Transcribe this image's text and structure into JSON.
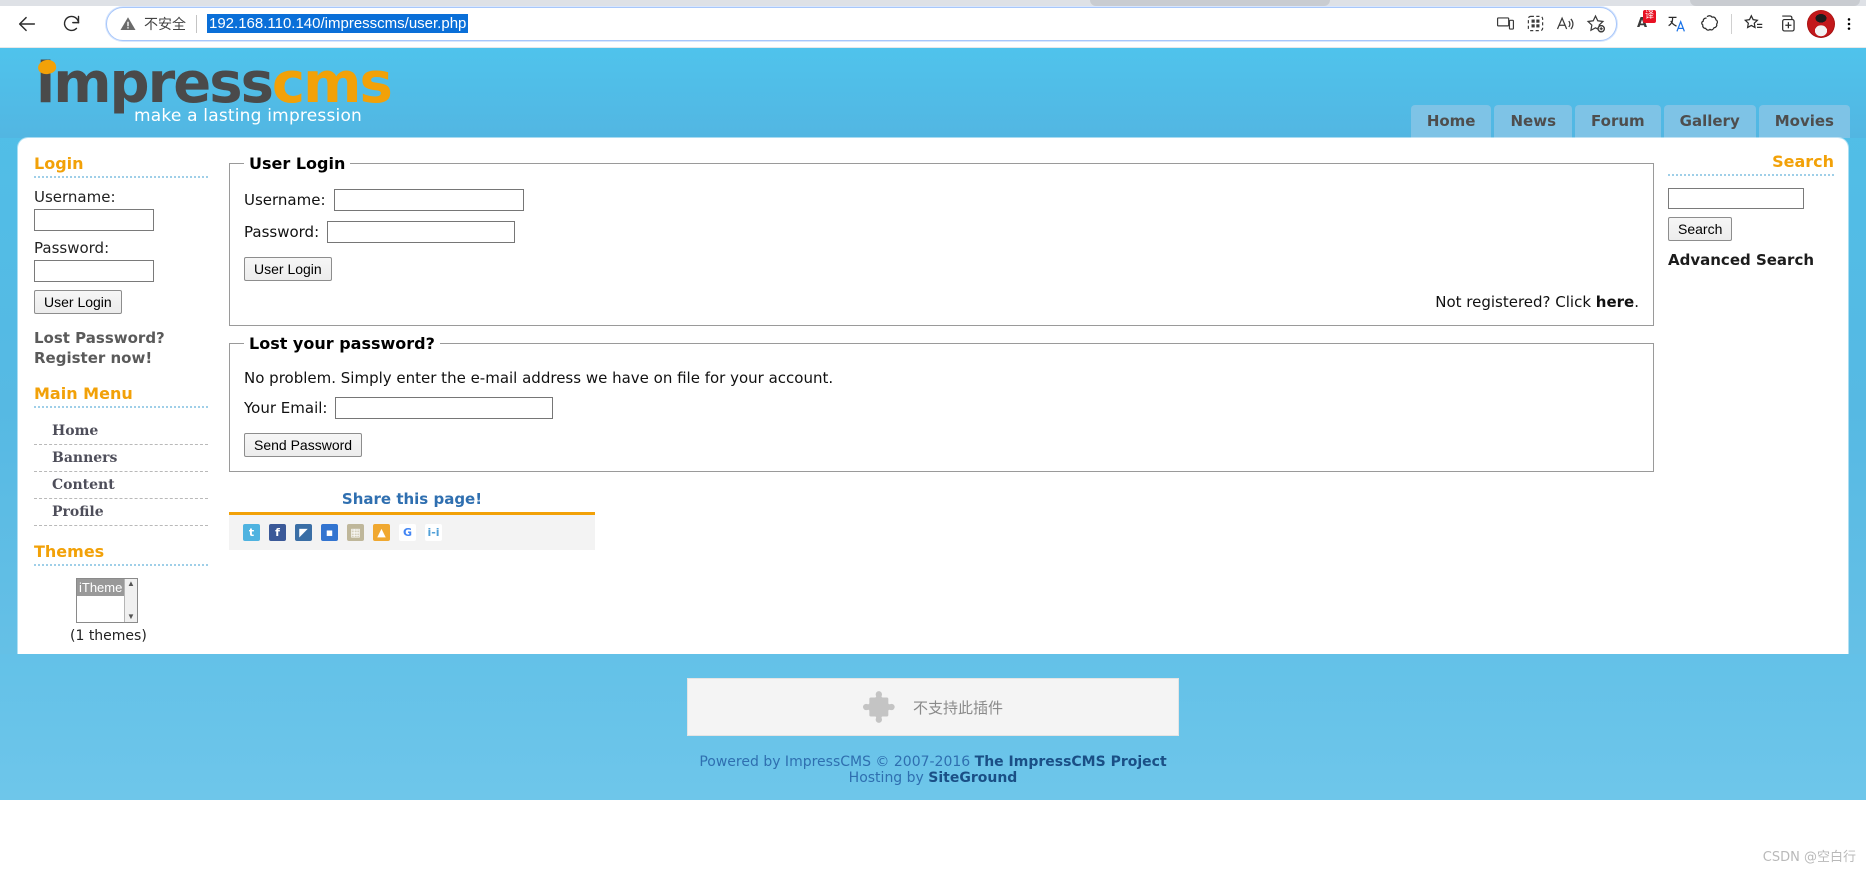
{
  "browser": {
    "back_icon": "back-arrow-icon",
    "reload_icon": "reload-icon",
    "security_warning_icon": "warning-triangle-icon",
    "security_text": "不安全",
    "url": "192.168.110.140/impresscms/user.php",
    "omnibox_icons": [
      "cast-device-icon",
      "split-screen-icon",
      "read-aloud-icon",
      "add-favorite-icon"
    ],
    "toolbar_icons": [
      "translate-badge-icon",
      "translate-icon",
      "copilot-icon",
      "favorites-list-icon",
      "collections-icon",
      "profile-avatar",
      "more-options-icon"
    ],
    "translate_badge": "译"
  },
  "site": {
    "logo": {
      "part1": "impress",
      "part2": "cms",
      "tagline": "make a lasting impression"
    },
    "topnav": [
      {
        "label": "Home"
      },
      {
        "label": "News"
      },
      {
        "label": "Forum"
      },
      {
        "label": "Gallery"
      },
      {
        "label": "Movies"
      }
    ]
  },
  "sidebar": {
    "login_block": {
      "title": "Login",
      "username_label": "Username:",
      "password_label": "Password:",
      "submit_label": "User Login",
      "lost_password": "Lost Password?",
      "register": "Register now!"
    },
    "main_menu": {
      "title": "Main Menu",
      "items": [
        {
          "label": "Home"
        },
        {
          "label": "Banners"
        },
        {
          "label": "Content"
        },
        {
          "label": "Profile"
        }
      ]
    },
    "themes": {
      "title": "Themes",
      "selected_option": "iTheme",
      "count_text": "(1 themes)"
    }
  },
  "main": {
    "user_login": {
      "legend": "User Login",
      "username_label": "Username:",
      "password_label": "Password:",
      "submit_label": "User Login",
      "not_registered_prefix": "Not registered? Click ",
      "not_registered_link": "here",
      "not_registered_suffix": "."
    },
    "lost_password": {
      "legend": "Lost your password?",
      "description": "No problem. Simply enter the e-mail address we have on file for your account.",
      "email_label": "Your Email:",
      "submit_label": "Send Password"
    },
    "share": {
      "title": "Share this page!",
      "icons": [
        {
          "name": "twitter-icon",
          "glyph": "t",
          "color": "#4fb3e0"
        },
        {
          "name": "facebook-icon",
          "glyph": "f",
          "color": "#3b5998"
        },
        {
          "name": "windows-live-icon",
          "glyph": "",
          "color": "#3a6ea5"
        },
        {
          "name": "delicious-icon",
          "glyph": "",
          "color": "#3274d0"
        },
        {
          "name": "stumbleupon-icon",
          "glyph": "",
          "color": "#bfb79a"
        },
        {
          "name": "furl-icon",
          "glyph": "",
          "color": "#f0a830"
        },
        {
          "name": "google-icon",
          "glyph": "G",
          "color": "#4285f4"
        },
        {
          "name": "mixx-icon",
          "glyph": "",
          "color": "#50a0d8"
        }
      ]
    }
  },
  "search": {
    "title": "Search",
    "button_label": "Search",
    "advanced_label": "Advanced Search"
  },
  "footer": {
    "plugin_notice": "不支持此插件",
    "powered_prefix": "Powered by ImpressCMS © 2007-2016 ",
    "powered_project": "The ImpressCMS Project",
    "hosting_prefix": "Hosting by ",
    "hosting_name": "SiteGround",
    "watermark": "CSDN @空白行"
  }
}
